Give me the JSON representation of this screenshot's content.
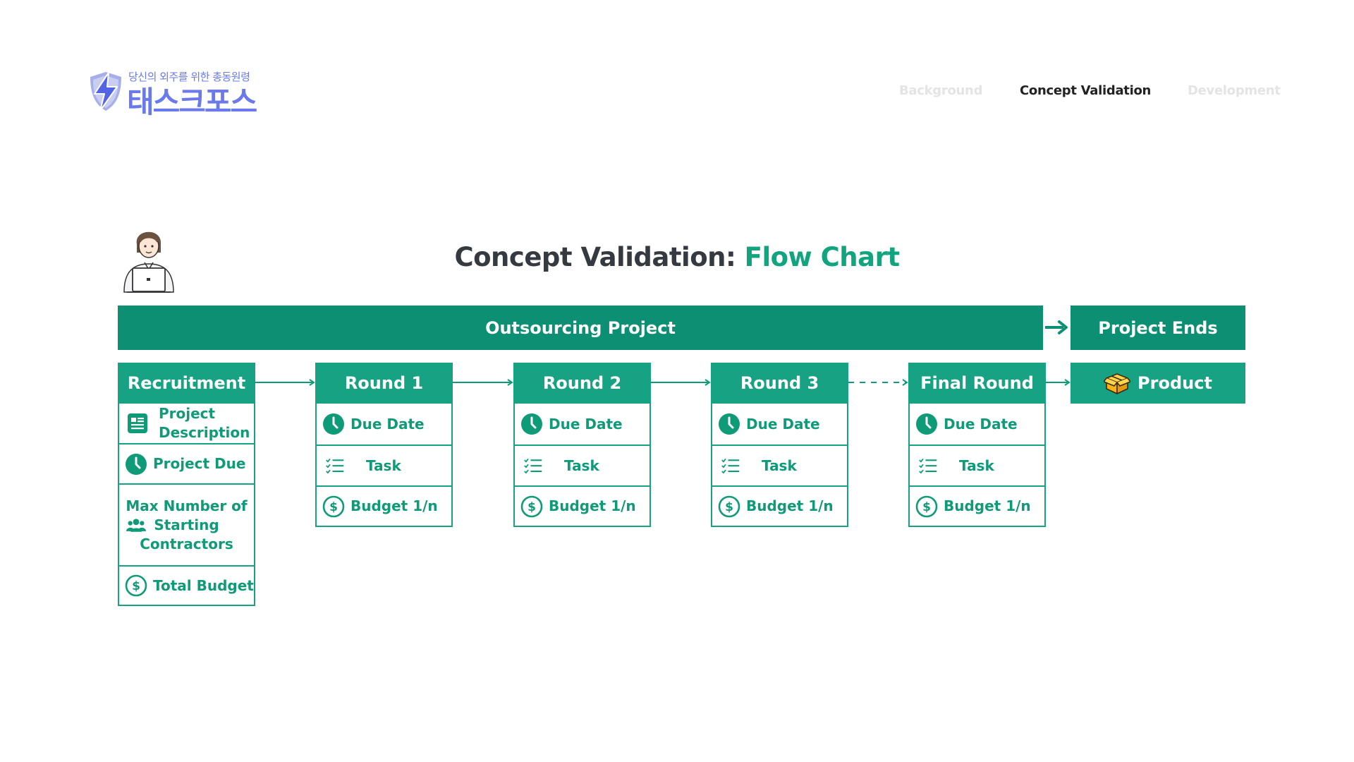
{
  "logo": {
    "tagline": "당신의 외주를 위한 총동원령",
    "name": "태스크포스",
    "icon": "lightning-shield-icon",
    "color": "#6a79ec"
  },
  "nav": [
    {
      "label": "Background",
      "state": "inactive"
    },
    {
      "label": "Concept Validation",
      "state": "active"
    },
    {
      "label": "Development",
      "state": "inactive"
    }
  ],
  "title": {
    "prefix": "Concept Validation: ",
    "accent": "Flow Chart"
  },
  "illustration": "person-with-laptop-icon",
  "colors": {
    "band": "#0c8f73",
    "header": "#17a383",
    "text_accent": "#12a37f",
    "title": "#343a40"
  },
  "flow": {
    "band_main": "Outsourcing Project",
    "band_end": "Project Ends",
    "recruitment": {
      "header": "Recruitment",
      "items": [
        {
          "icon": "document-icon",
          "label_line1": "Project",
          "label_line2": "Description"
        },
        {
          "icon": "clock-icon",
          "label": "Project Due"
        },
        {
          "icon": "group-icon",
          "label_line1": "Max Number of",
          "label_line2": "Starting",
          "label_line3": "Contractors"
        },
        {
          "icon": "dollar-icon",
          "label": "Total Budget"
        }
      ]
    },
    "rounds": [
      {
        "header": "Round 1",
        "due": "Due Date",
        "task": "Task",
        "budget": "Budget 1/n"
      },
      {
        "header": "Round 2",
        "due": "Due Date",
        "task": "Task",
        "budget": "Budget 1/n"
      },
      {
        "header": "Round 3",
        "due": "Due Date",
        "task": "Task",
        "budget": "Budget 1/n"
      },
      {
        "header": "Final Round",
        "due": "Due Date",
        "task": "Task",
        "budget": "Budget 1/n"
      }
    ],
    "product": {
      "header": "Product",
      "icon": "package-icon"
    }
  }
}
